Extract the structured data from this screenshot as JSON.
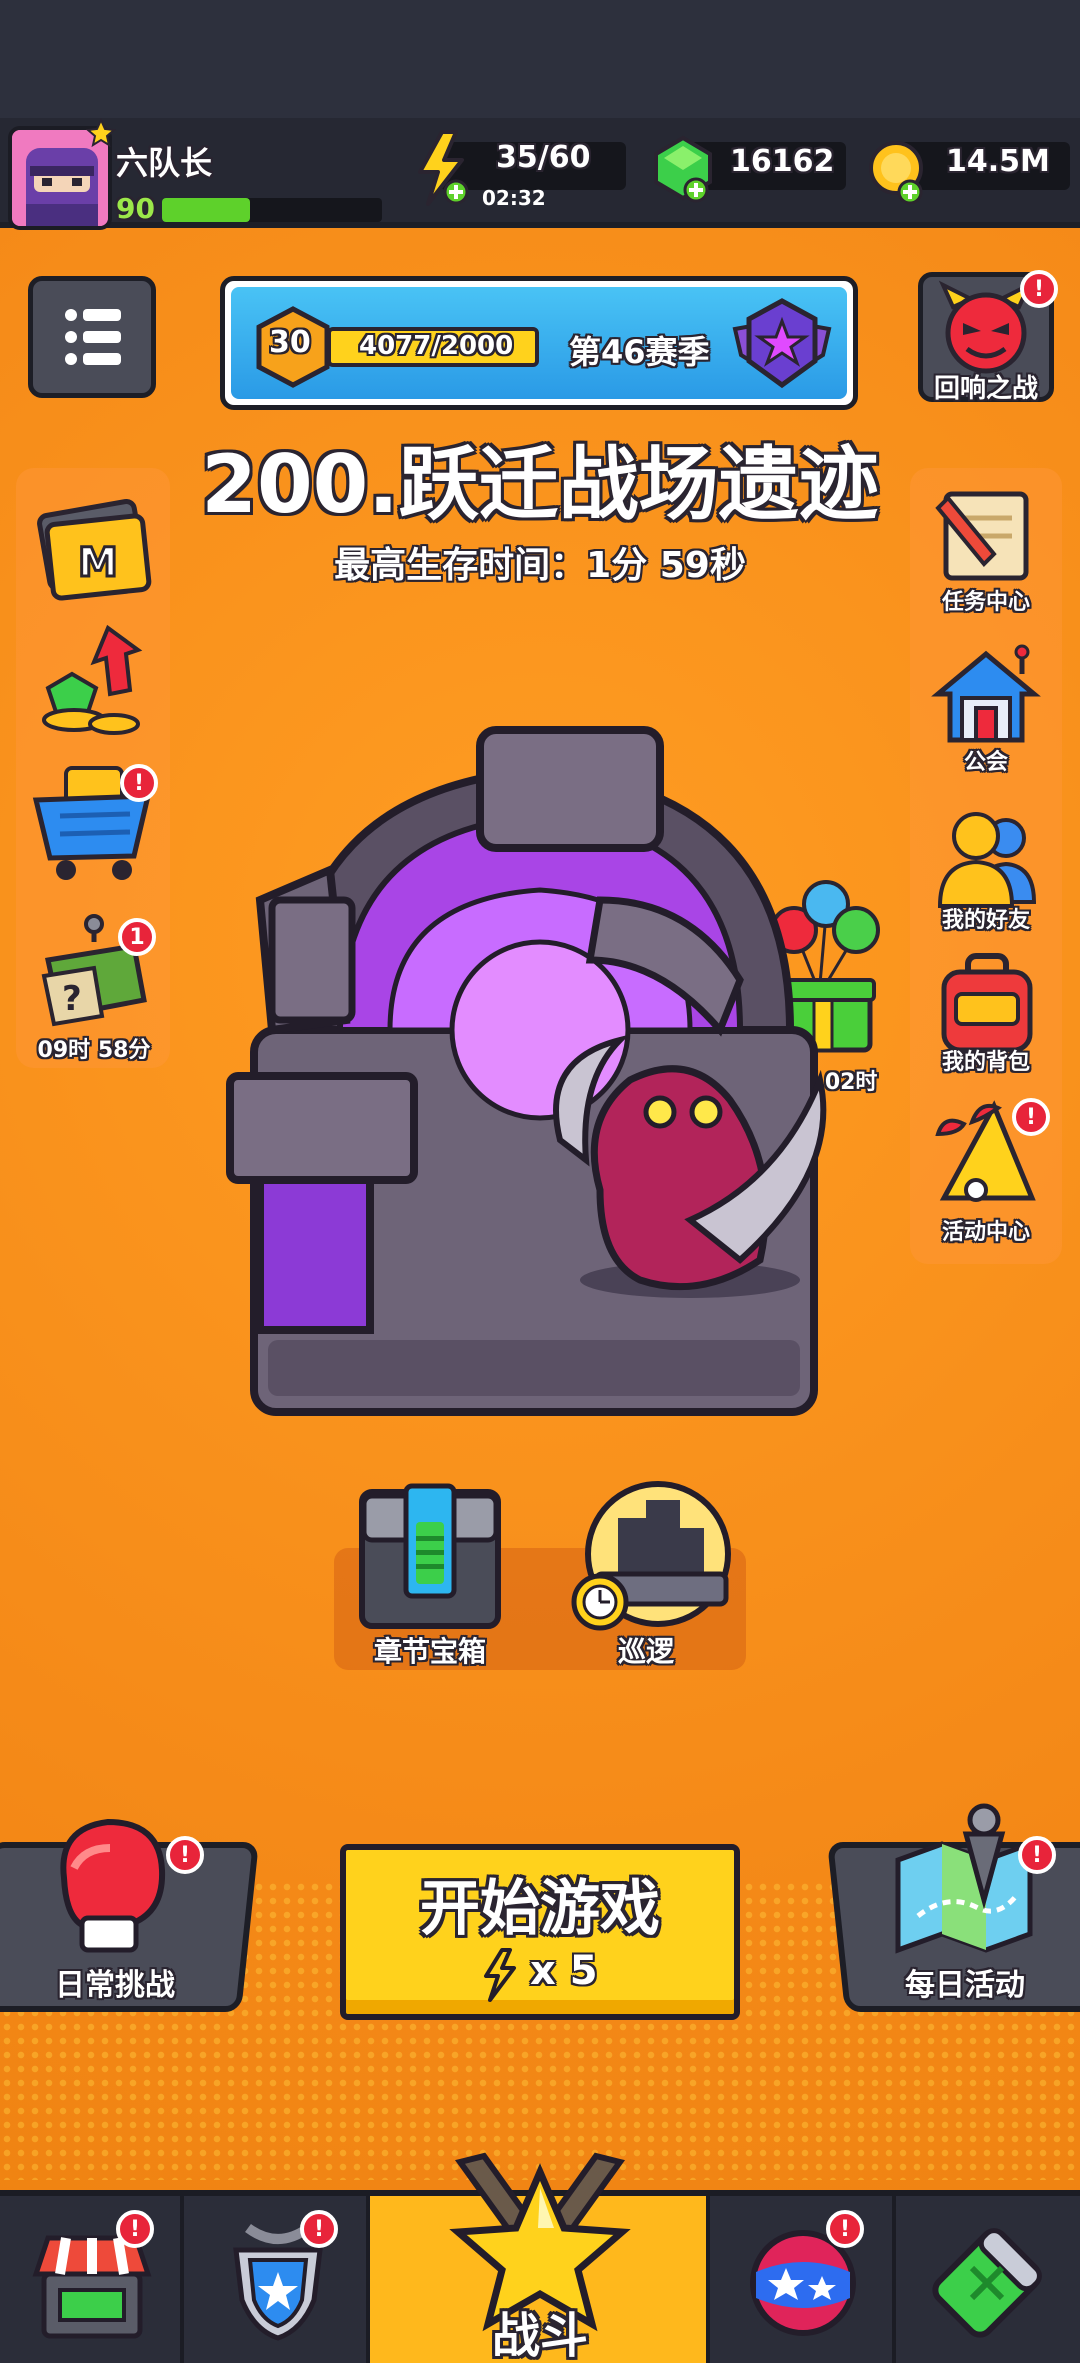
{
  "player": {
    "name": "六队长",
    "level": "90",
    "xp_fraction": 0.4
  },
  "resources": {
    "energy": "35/60",
    "energy_timer": "02:32",
    "gems": "16162",
    "coins": "14.5M"
  },
  "season": {
    "rank_level": "30",
    "progress_text": "4077/2000",
    "season_label": "第46赛季"
  },
  "stage": {
    "title": "200.跃迁战场遗迹",
    "best_survival": "最高生存时间：1分 59秒"
  },
  "left_icons": {
    "box_timer": "09时 58分",
    "box_badge": "1"
  },
  "right_icons": {
    "echo_battle": "回响之战",
    "task_center": "任务中心",
    "guild": "公会",
    "friends": "我的好友",
    "backpack": "我的背包",
    "events_center": "活动中心",
    "gift_timer": "02天 02时"
  },
  "center_items": {
    "chapter_chest": "章节宝箱",
    "patrol": "巡逻"
  },
  "actions": {
    "daily_challenge": "日常挑战",
    "start_game": "开始游戏",
    "start_cost": "x 5",
    "daily_activity": "每日活动"
  },
  "nav": {
    "battle": "战斗"
  },
  "badges": {
    "alert": "!"
  },
  "colors": {
    "background": "#f6921e",
    "accent_yellow": "#ffd21c",
    "alert_red": "#e8243a",
    "panel_dark": "#2b2d39"
  }
}
